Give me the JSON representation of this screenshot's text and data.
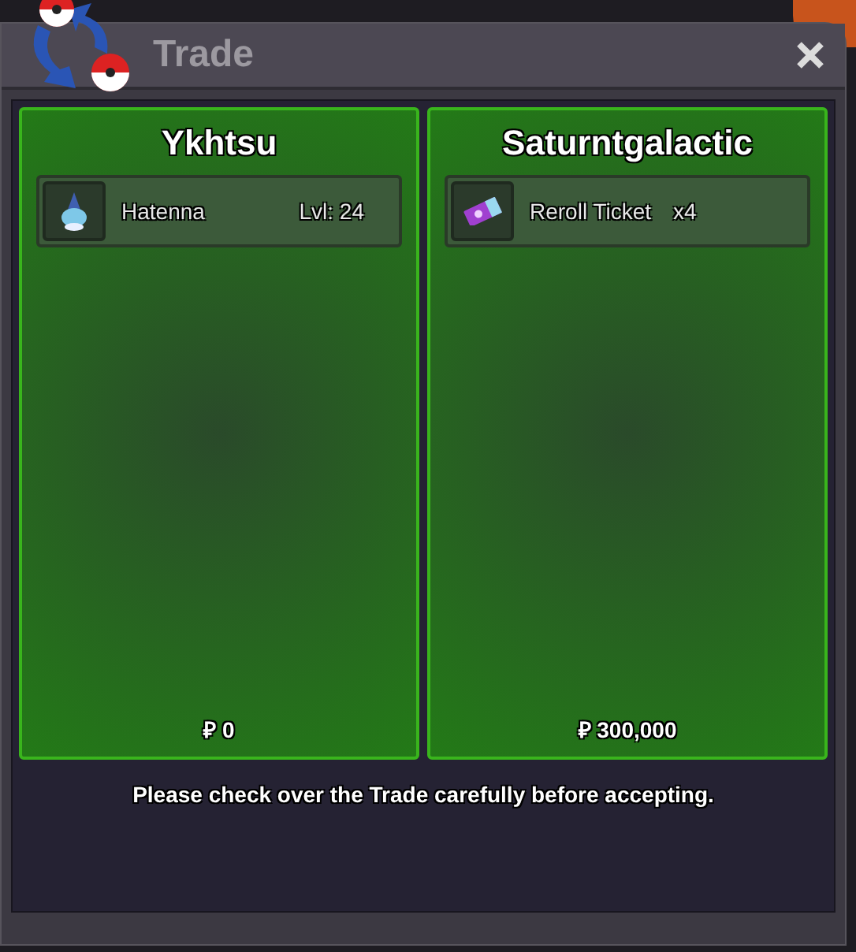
{
  "window": {
    "title": "Trade"
  },
  "traders": [
    {
      "name": "Ykhtsu",
      "offers": [
        {
          "kind": "pokemon",
          "name": "Hatenna",
          "detail": "Lvl: 24"
        }
      ],
      "money": "₽ 0"
    },
    {
      "name": "Saturntgalactic",
      "offers": [
        {
          "kind": "item",
          "name": "Reroll Ticket",
          "detail": "x4"
        }
      ],
      "money": "₽ 300,000"
    }
  ],
  "notice": "Please check over the Trade carefully before accepting."
}
